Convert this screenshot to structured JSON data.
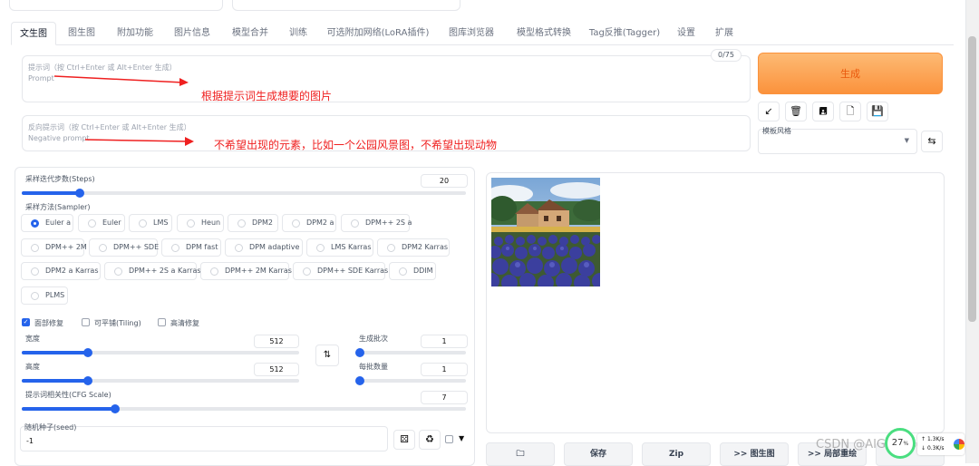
{
  "tabs": [
    {
      "label": "文生图"
    },
    {
      "label": "图生图"
    },
    {
      "label": "附加功能"
    },
    {
      "label": "图片信息"
    },
    {
      "label": "模型合并"
    },
    {
      "label": "训练"
    },
    {
      "label": "可选附加网络(LoRA插件)"
    },
    {
      "label": "图库浏览器"
    },
    {
      "label": "模型格式转换"
    },
    {
      "label": "Tag反推(Tagger)"
    },
    {
      "label": "设置"
    },
    {
      "label": "扩展"
    }
  ],
  "prompt": {
    "placeholder_line1": "提示词（按 Ctrl+Enter 或 Alt+Enter 生成）",
    "placeholder_line2": "Prompt",
    "counter": "0/75"
  },
  "negative_prompt": {
    "placeholder_line1": "反向提示词（按 Ctrl+Enter 或 Alt+Enter 生成）",
    "placeholder_line2": "Negative prompt"
  },
  "annotations": {
    "prompt": "根据提示词生成想要的图片",
    "negative": "不希望出现的元素，比如一个公园风景图，不希望出现动物"
  },
  "generate_label": "生成",
  "tools": [
    {
      "icon": "arrow-icon",
      "glyph": "↙"
    },
    {
      "icon": "trash-icon",
      "glyph": "🗑"
    },
    {
      "icon": "save-style-icon",
      "glyph": "🖪"
    },
    {
      "icon": "apply-style-icon",
      "glyph": "🗋"
    },
    {
      "icon": "disk-icon",
      "glyph": "💾"
    }
  ],
  "styles": {
    "label": "模板风格",
    "value": ""
  },
  "steps": {
    "label": "采样迭代步数(Steps)",
    "value": "20",
    "fraction": 0.13
  },
  "sampler": {
    "label": "采样方法(Sampler)",
    "options": [
      "Euler a",
      "Euler",
      "LMS",
      "Heun",
      "DPM2",
      "DPM2 a",
      "DPM++ 2S a",
      "DPM++ 2M",
      "DPM++ SDE",
      "DPM fast",
      "DPM adaptive",
      "LMS Karras",
      "DPM2 Karras",
      "DPM2 a Karras",
      "DPM++ 2S a Karras",
      "DPM++ 2M Karras",
      "DPM++ SDE Karras",
      "DDIM",
      "PLMS"
    ],
    "selected": "Euler a"
  },
  "checks": [
    {
      "label": "面部修复",
      "checked": true
    },
    {
      "label": "可平铺(Tiling)",
      "checked": false
    },
    {
      "label": "高清修复",
      "checked": false
    }
  ],
  "width": {
    "label": "宽度",
    "value": "512",
    "fraction": 0.24
  },
  "height": {
    "label": "高度",
    "value": "512",
    "fraction": 0.24
  },
  "batch_count": {
    "label": "生成批次",
    "value": "1",
    "fraction": 0.0
  },
  "batch_size": {
    "label": "每批数量",
    "value": "1",
    "fraction": 0.0
  },
  "cfg": {
    "label": "提示词相关性(CFG Scale)",
    "value": "7",
    "fraction": 0.21
  },
  "seed": {
    "label": "随机种子(seed)",
    "value": "-1"
  },
  "bottom_buttons": [
    "保存",
    "Zip",
    ">> 图生图",
    ">> 局部重绘"
  ],
  "watermark": "CSDN @AIGC Dison",
  "perf": {
    "percent": "27",
    "unit": "%",
    "up": "1.3K/s",
    "down": "0.3K/s"
  },
  "colors": {
    "accent": "#2563eb",
    "generate_bg": "#fdba74",
    "annotation": "#ef2020"
  }
}
